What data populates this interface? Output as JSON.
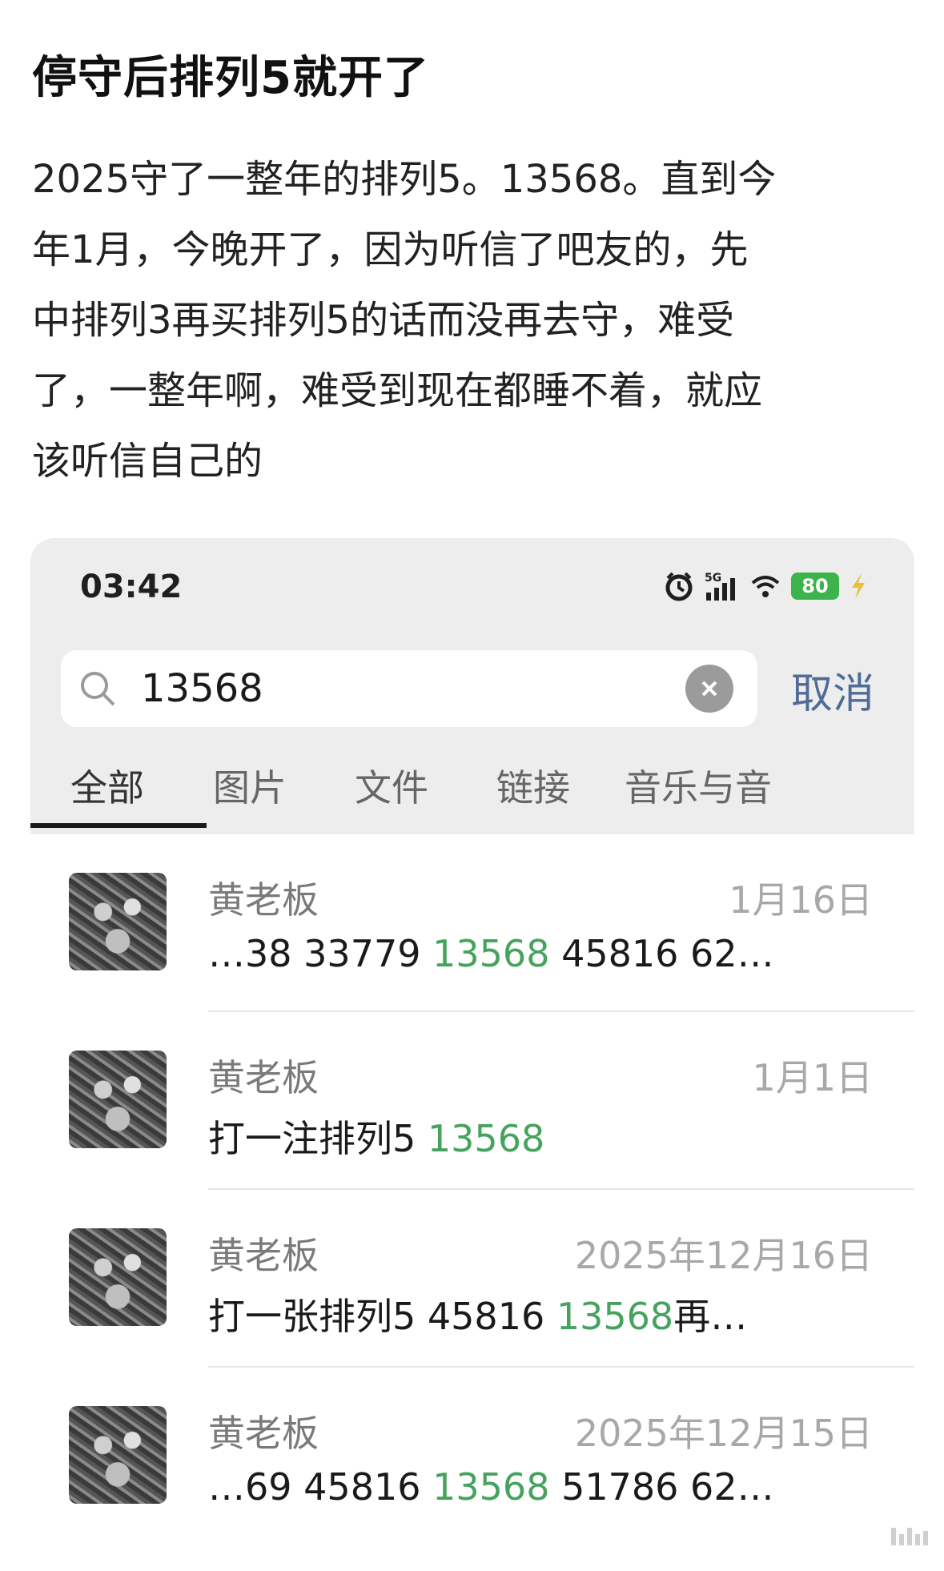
{
  "post": {
    "title": "停守后排列5就开了",
    "body": "2025守了一整年的排列5。13568。直到今\n年1月，今晚开了，因为听信了吧友的，先\n中排列3再买排列5的话而没再去守，难受\n了，一整年啊，难受到现在都睡不着，就应\n该听信自己的"
  },
  "phone": {
    "time": "03:42",
    "battery": "80",
    "network": "5G",
    "search": {
      "value": "13568",
      "cancel_label": "取消"
    },
    "tabs": [
      "全部",
      "图片",
      "文件",
      "链接",
      "音乐与音"
    ],
    "results": [
      {
        "name": "黄老板",
        "date": "1月16日",
        "pre": "…38 33779 ",
        "hit": "13568",
        "post": " 45816 62…"
      },
      {
        "name": "黄老板",
        "date": "1月1日",
        "pre": "打一注排列5 ",
        "hit": "13568",
        "post": ""
      },
      {
        "name": "黄老板",
        "date": "2025年12月16日",
        "pre": "打一张排列5 45816 ",
        "hit": "13568",
        "post": "再…"
      },
      {
        "name": "黄老板",
        "date": "2025年12月15日",
        "pre": "…69 45816 ",
        "hit": "13568",
        "post": " 51786 62…"
      }
    ],
    "colors": {
      "highlight": "#46a35e",
      "cancel": "#4f6b96",
      "battery": "#3cb44b"
    }
  }
}
